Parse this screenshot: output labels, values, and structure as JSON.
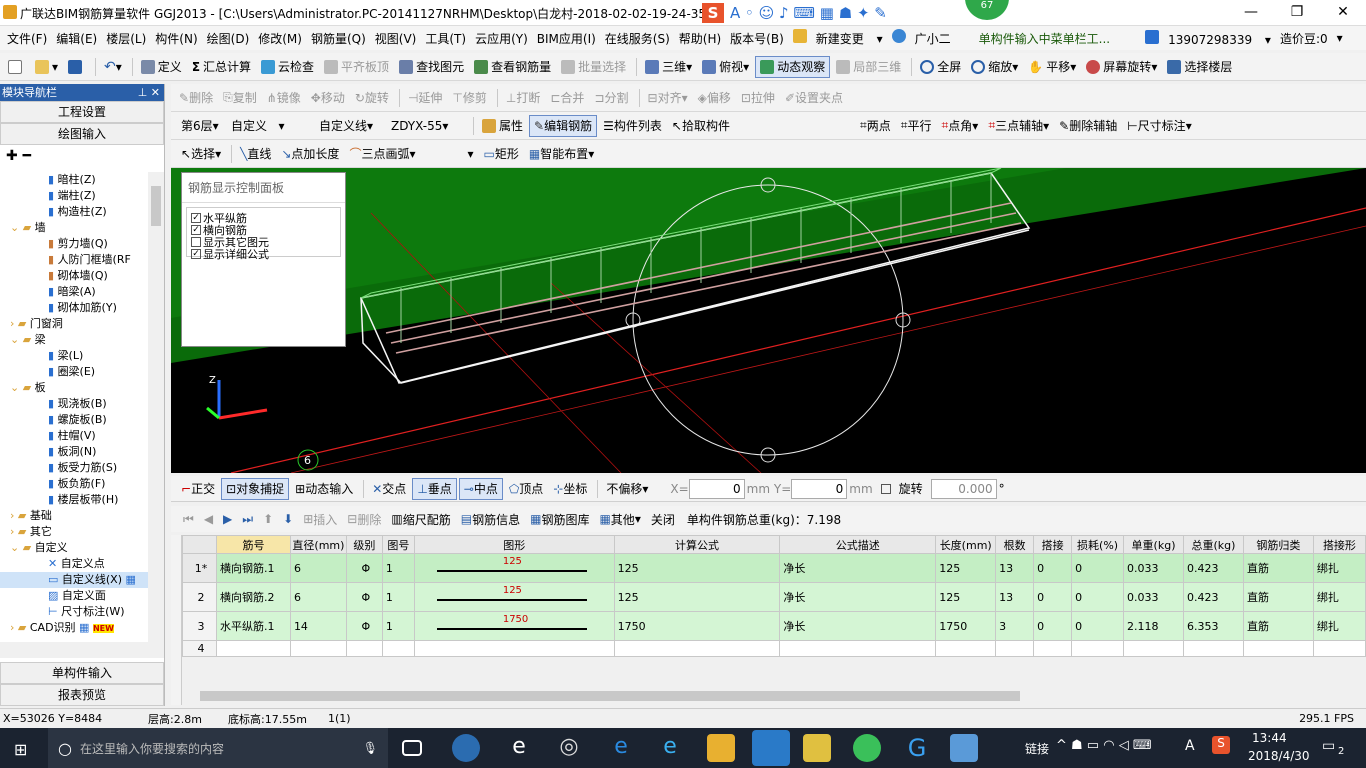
{
  "title": "广联达BIM钢筋算量软件 GGJ2013 - [C:\\Users\\Administrator.PC-20141127NRHM\\Desktop\\白龙村-2018-02-02-19-24-35",
  "badge_count": "67",
  "menu": [
    "文件(F)",
    "编辑(E)",
    "楼层(L)",
    "构件(N)",
    "绘图(D)",
    "修改(M)",
    "钢筋量(Q)",
    "视图(V)",
    "工具(T)",
    "云应用(Y)",
    "BIM应用(I)",
    "在线服务(S)",
    "帮助(H)",
    "版本号(B)",
    "新建变更",
    "广小二",
    "单构件输入中菜单栏工...",
    "13907298339",
    "造价豆:0"
  ],
  "toolbar1": [
    "定义",
    "汇总计算",
    "云检查",
    "平齐板顶",
    "查找图元",
    "查看钢筋量",
    "批量选择",
    "三维",
    "俯视",
    "动态观察",
    "局部三维",
    "全屏",
    "缩放",
    "平移",
    "屏幕旋转",
    "选择楼层"
  ],
  "toolbar2": [
    "删除",
    "复制",
    "镜像",
    "移动",
    "旋转",
    "延伸",
    "修剪",
    "打断",
    "合并",
    "分割",
    "对齐",
    "偏移",
    "拉伸",
    "设置夹点"
  ],
  "toolbar3": {
    "floor": "第6层",
    "custom": "自定义",
    "line": "自定义线",
    "code": "ZDYX-55",
    "items": [
      "属性",
      "编辑钢筋",
      "构件列表",
      "拾取构件",
      "两点",
      "平行",
      "点角",
      "三点辅轴",
      "删除辅轴",
      "尺寸标注"
    ]
  },
  "toolbar4": [
    "选择",
    "直线",
    "点加长度",
    "三点画弧",
    "矩形",
    "智能布置"
  ],
  "panel": {
    "title": "模块导航栏",
    "btn1": "工程设置",
    "btn2": "绘图输入",
    "bottom1": "单构件输入",
    "bottom2": "报表预览"
  },
  "tree": [
    "暗柱(Z)",
    "端柱(Z)",
    "构造柱(Z)",
    "墙",
    "剪力墙(Q)",
    "人防门框墙(RF",
    "砌体墙(Q)",
    "暗梁(A)",
    "砌体加筋(Y)",
    "门窗洞",
    "梁",
    "梁(L)",
    "圈梁(E)",
    "板",
    "现浇板(B)",
    "螺旋板(B)",
    "柱帽(V)",
    "板洞(N)",
    "板受力筋(S)",
    "板负筋(F)",
    "楼层板带(H)",
    "基础",
    "其它",
    "自定义",
    "自定义点",
    "自定义线(X)",
    "自定义面",
    "尺寸标注(W)",
    "CAD识别"
  ],
  "new_tag": "NEW",
  "ctrlpanel": {
    "title": "钢筋显示控制面板",
    "opts": [
      "水平纵筋",
      "横向钢筋",
      "显示其它图元",
      "显示详细公式"
    ]
  },
  "axis_label": "6",
  "snapbar": {
    "items": [
      "正交",
      "对象捕捉",
      "动态输入",
      "交点",
      "垂点",
      "中点",
      "顶点",
      "坐标"
    ],
    "offset": "不偏移",
    "x_label": "X=",
    "x": "0",
    "y_label": "mm Y=",
    "y": "0",
    "mm": "mm",
    "rotate": "旋转",
    "angle": "0.000",
    "deg": "°"
  },
  "rebarbar": {
    "items": [
      "插入",
      "删除",
      "缩尺配筋",
      "钢筋信息",
      "钢筋图库",
      "其他",
      "关闭"
    ],
    "total": "单构件钢筋总重(kg)：7.198"
  },
  "table": {
    "headers": [
      "",
      "筋号",
      "直径(mm)",
      "级别",
      "图号",
      "图形",
      "计算公式",
      "公式描述",
      "长度(mm)",
      "根数",
      "搭接",
      "损耗(%)",
      "单重(kg)",
      "总重(kg)",
      "钢筋归类",
      "搭接形"
    ],
    "rows": [
      [
        "1*",
        "横向钢筋.1",
        "6",
        "Φ",
        "1",
        "125",
        "125",
        "净长",
        "125",
        "13",
        "0",
        "0",
        "0.033",
        "0.423",
        "直筋",
        "绑扎"
      ],
      [
        "2",
        "横向钢筋.2",
        "6",
        "Φ",
        "1",
        "125",
        "125",
        "净长",
        "125",
        "13",
        "0",
        "0",
        "0.033",
        "0.423",
        "直筋",
        "绑扎"
      ],
      [
        "3",
        "水平纵筋.1",
        "14",
        "Φ",
        "1",
        "1750",
        "1750",
        "净长",
        "1750",
        "3",
        "0",
        "0",
        "2.118",
        "6.353",
        "直筋",
        "绑扎"
      ],
      [
        "4",
        "",
        "",
        "",
        "",
        "",
        "",
        "",
        "",
        "",
        "",
        "",
        "",
        "",
        "",
        ""
      ]
    ]
  },
  "status": {
    "coords": "X=53026 Y=8484",
    "floor_h": "层高:2.8m",
    "base_h": "底标高:17.55m",
    "count": "1(1)",
    "fps": "295.1 FPS"
  },
  "taskbar": {
    "search": "在这里输入你要搜索的内容",
    "link": "链接",
    "time": "13:44",
    "date": "2018/4/30",
    "notif": "2",
    "ime": "A"
  },
  "colors": {
    "accent": "#2a5fa8",
    "grid_green": "#d4f5d4",
    "viewport": "#000000",
    "green_floor": "#0a6b0a"
  }
}
